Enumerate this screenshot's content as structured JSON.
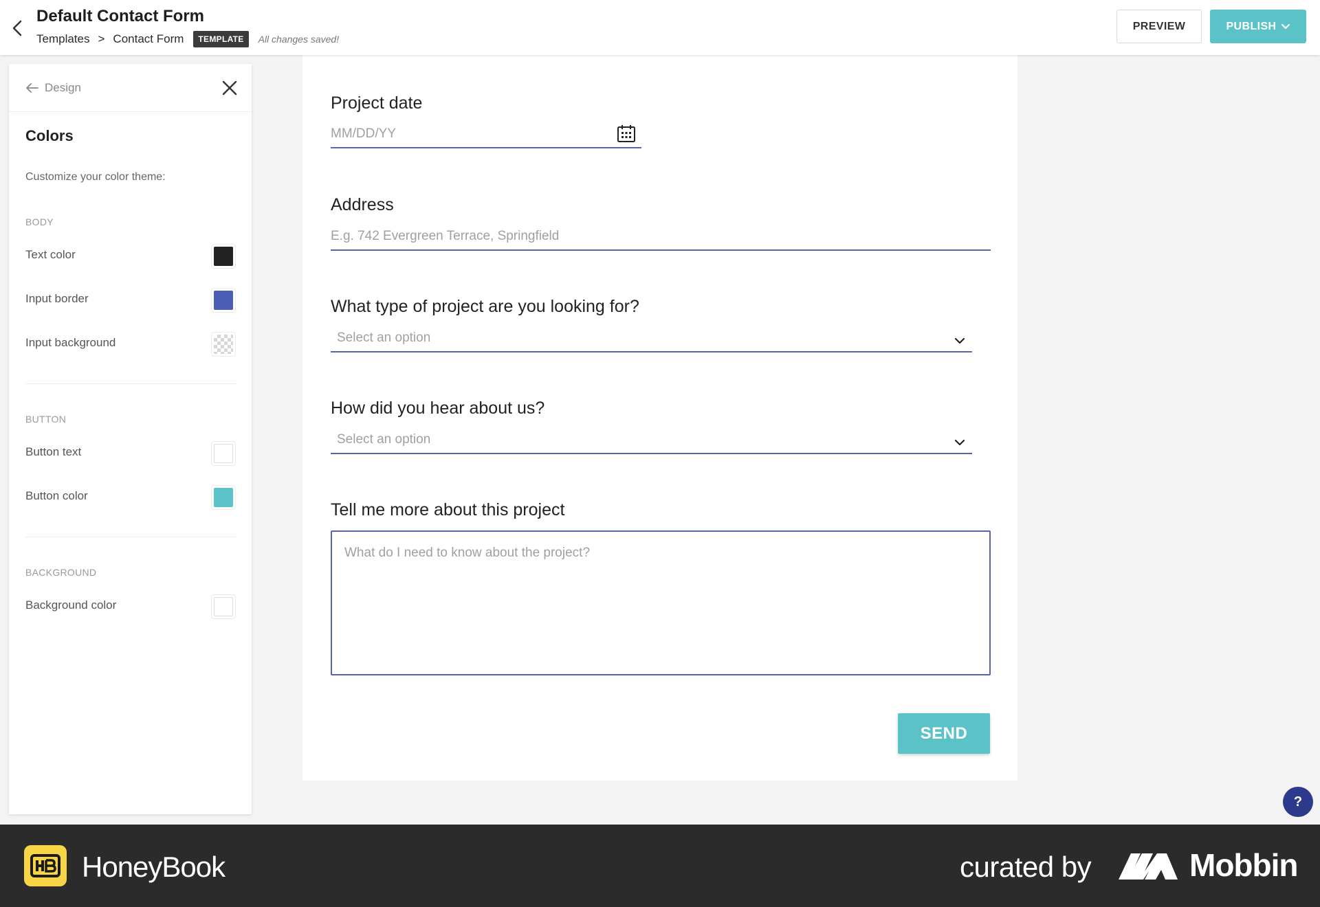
{
  "header": {
    "title": "Default Contact Form",
    "breadcrumb": [
      "Templates",
      "Contact Form"
    ],
    "breadcrumb_separator": ">",
    "badge": "TEMPLATE",
    "save_status": "All changes saved!",
    "preview_label": "PREVIEW",
    "publish_label": "PUBLISH"
  },
  "panel": {
    "back_label": "Design",
    "title": "Colors",
    "subtitle": "Customize your color theme:",
    "sections": {
      "body": {
        "label": "BODY",
        "items": [
          {
            "label": "Text color",
            "color": "#222222"
          },
          {
            "label": "Input border",
            "color": "#4a5fb5"
          },
          {
            "label": "Input background",
            "color": "transparent"
          }
        ]
      },
      "button": {
        "label": "BUTTON",
        "items": [
          {
            "label": "Button text",
            "color": "#ffffff"
          },
          {
            "label": "Button color",
            "color": "#5bc3c8"
          }
        ]
      },
      "background": {
        "label": "BACKGROUND",
        "items": [
          {
            "label": "Background color",
            "color": "#ffffff"
          }
        ]
      }
    }
  },
  "form": {
    "project_date": {
      "label": "Project date",
      "placeholder": "MM/DD/YY"
    },
    "address": {
      "label": "Address",
      "placeholder": "E.g. 742 Evergreen Terrace, Springfield"
    },
    "project_type": {
      "label": "What type of project are you looking for?",
      "placeholder": "Select an option"
    },
    "referral": {
      "label": "How did you hear about us?",
      "placeholder": "Select an option"
    },
    "details": {
      "label": "Tell me more about this project",
      "placeholder": "What do I need to know about the project?"
    },
    "send_label": "SEND"
  },
  "help_label": "?",
  "footer": {
    "brand": "HoneyBook",
    "curated_by": "curated by",
    "curator": "Mobbin"
  },
  "colors": {
    "accent": "#5bc3c8",
    "input_border": "#5566a6",
    "help_button": "#2d3a8c",
    "footer_bg": "#2b2b2b",
    "honeybook_yellow": "#f8d547"
  }
}
